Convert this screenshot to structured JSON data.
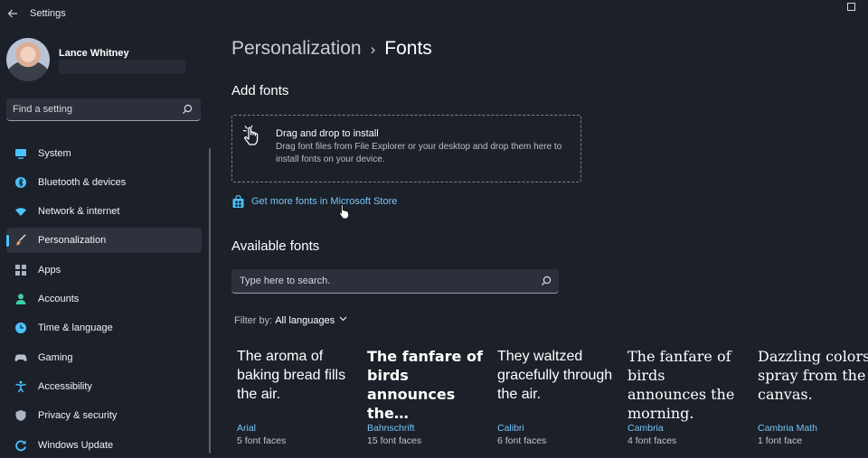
{
  "window": {
    "title": "Settings"
  },
  "user": {
    "name": "Lance Whitney"
  },
  "sidebar": {
    "search_placeholder": "Find a setting",
    "items": [
      {
        "label": "System",
        "icon": "monitor-icon",
        "color": "#4cc2ff"
      },
      {
        "label": "Bluetooth & devices",
        "icon": "bluetooth-icon",
        "color": "#4cc2ff"
      },
      {
        "label": "Network & internet",
        "icon": "wifi-icon",
        "color": "#4cc2ff"
      },
      {
        "label": "Personalization",
        "icon": "brush-icon",
        "color": "#f0a35e",
        "active": true
      },
      {
        "label": "Apps",
        "icon": "apps-icon",
        "color": "#aab4c3"
      },
      {
        "label": "Accounts",
        "icon": "person-icon",
        "color": "#3ccfa4"
      },
      {
        "label": "Time & language",
        "icon": "globe-clock-icon",
        "color": "#4cc2ff"
      },
      {
        "label": "Gaming",
        "icon": "gamepad-icon",
        "color": "#b8bfca"
      },
      {
        "label": "Accessibility",
        "icon": "accessibility-icon",
        "color": "#4cc2ff"
      },
      {
        "label": "Privacy & security",
        "icon": "shield-icon",
        "color": "#aab4c3"
      },
      {
        "label": "Windows Update",
        "icon": "update-icon",
        "color": "#4cc2ff"
      }
    ]
  },
  "breadcrumb": {
    "parent": "Personalization",
    "separator": "›",
    "current": "Fonts"
  },
  "add_fonts": {
    "title": "Add fonts",
    "drop_title": "Drag and drop to install",
    "drop_description": "Drag font files from File Explorer or your desktop and drop them here to install fonts on your device.",
    "store_link": "Get more fonts in Microsoft Store"
  },
  "available_fonts": {
    "title": "Available fonts",
    "search_placeholder": "Type here to search.",
    "filter_label": "Filter by:",
    "filter_value": "All languages",
    "fonts": [
      {
        "sample": "The aroma of baking bread fills the air.",
        "name": "Arial",
        "faces": "5 font faces",
        "family": "Liberation Sans",
        "weight": "normal"
      },
      {
        "sample": "The fanfare of birds announces the…",
        "name": "Bahnschrift",
        "faces": "15 font faces",
        "family": "DejaVu Sans",
        "weight": "bold"
      },
      {
        "sample": "They waltzed gracefully through the air.",
        "name": "Calibri",
        "faces": "6 font faces",
        "family": "Liberation Sans",
        "weight": "normal"
      },
      {
        "sample": "The fanfare of birds announces the morning.",
        "name": "Cambria",
        "faces": "4 font faces",
        "family": "DejaVu Serif",
        "weight": "normal"
      },
      {
        "sample": "Dazzling colors spray from the canvas.",
        "name": "Cambria Math",
        "faces": "1 font face",
        "family": "DejaVu Serif",
        "weight": "normal"
      }
    ]
  },
  "colors": {
    "background": "#1c2029",
    "accent": "#4cc2ff",
    "link": "#74c6f7"
  }
}
